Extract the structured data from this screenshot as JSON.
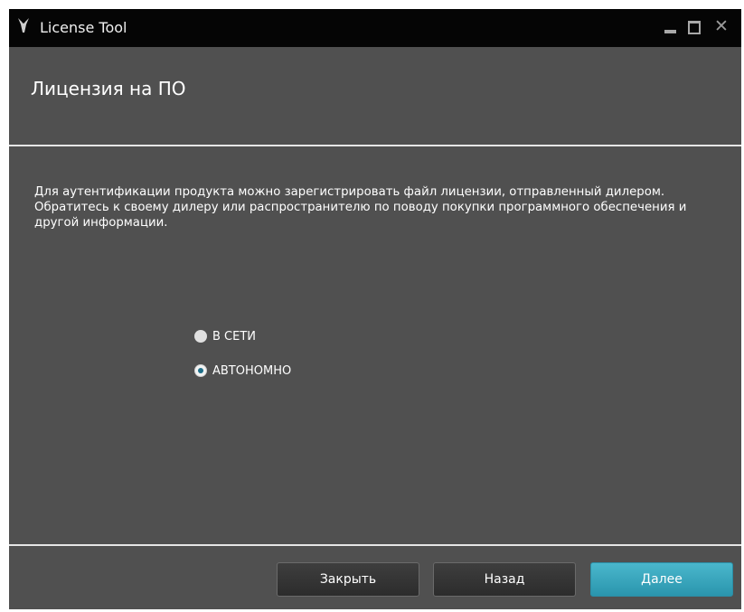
{
  "window": {
    "title": "License Tool",
    "controls": {
      "minimize": "minimize",
      "maximize": "maximize",
      "close": "✕"
    }
  },
  "page": {
    "title": "Лицензия на ПО",
    "description": [
      "Для аутентификации продукта можно зарегистрировать файл лицензии, отправленный дилером.",
      "Обратитесь к своему дилеру или распространителю по поводу покупки программного обеспечения и другой информации."
    ]
  },
  "license_mode": {
    "options": [
      {
        "label": "В СЕТИ",
        "selected": false
      },
      {
        "label": "АВТОНОМНО",
        "selected": true
      }
    ]
  },
  "buttons": {
    "close": "Закрыть",
    "back": "Назад",
    "next": "Далее"
  },
  "colors": {
    "background": "#505050",
    "titlebar": "#050505",
    "accent": "#36a6bd"
  }
}
